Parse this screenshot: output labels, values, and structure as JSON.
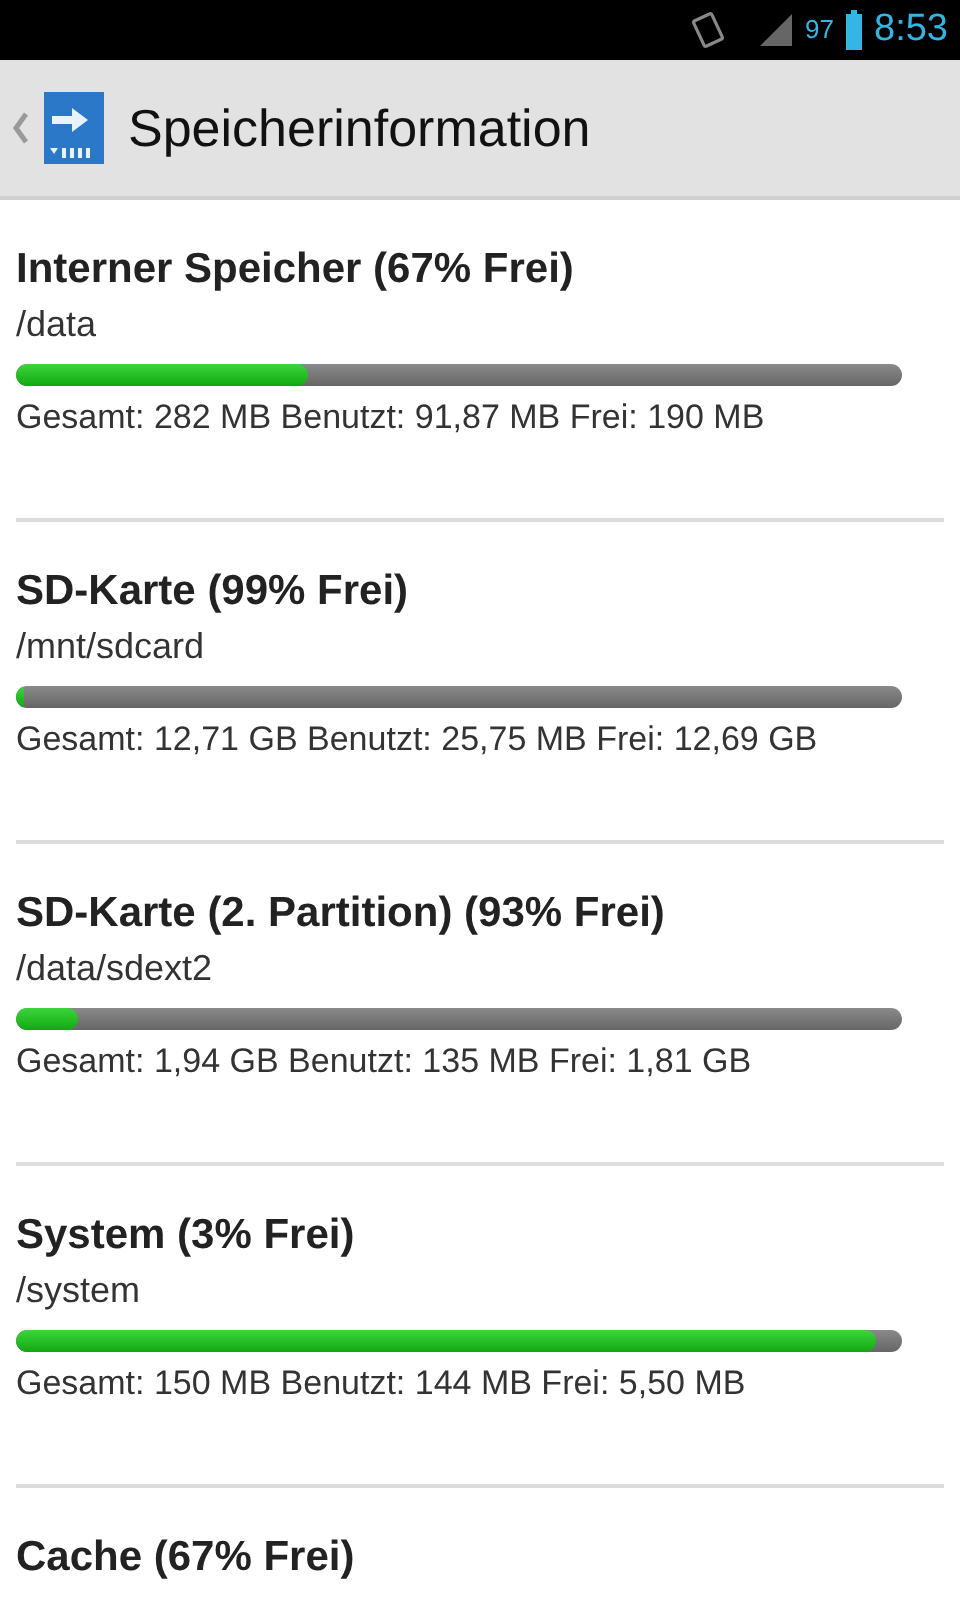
{
  "status_bar": {
    "battery": "97",
    "time": "8:53"
  },
  "action_bar": {
    "title": "Speicherinformation"
  },
  "storages": [
    {
      "title": "Interner Speicher (67% Frei)",
      "path": "/data",
      "level": 0.33,
      "details": "Gesamt: 282 MB Benutzt: 91,87 MB Frei: 190 MB"
    },
    {
      "title": "SD-Karte (99% Frei)",
      "path": "/mnt/sdcard",
      "level": 0.01,
      "details": "Gesamt: 12,71 GB Benutzt: 25,75 MB Frei: 12,69 GB"
    },
    {
      "title": "SD-Karte (2. Partition) (93% Frei)",
      "path": "/data/sdext2",
      "level": 0.07,
      "details": "Gesamt: 1,94 GB Benutzt: 135 MB Frei: 1,81 GB"
    },
    {
      "title": "System (3% Frei)",
      "path": "/system",
      "level": 0.97,
      "details": "Gesamt: 150 MB Benutzt: 144 MB Frei: 5,50 MB"
    },
    {
      "title": "Cache (67% Frei)"
    }
  ]
}
